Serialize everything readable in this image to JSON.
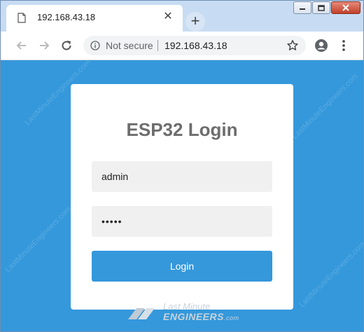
{
  "browser": {
    "tab_title": "192.168.43.18",
    "new_tab_symbol": "+",
    "security_label": "Not secure",
    "url": "192.168.43.18"
  },
  "login": {
    "title": "ESP32 Login",
    "username_value": "admin",
    "password_value": "•••••",
    "button_label": "Login"
  },
  "branding": {
    "line1": "Last Minute",
    "line2": "ENGINEERS",
    "suffix": ".com",
    "watermark": "LastMinuteEngineers.com"
  },
  "colors": {
    "page_background": "#3498db",
    "button": "#3498db",
    "card": "#ffffff",
    "title_text": "#6d6d6d",
    "field_background": "#f0f0f0"
  }
}
